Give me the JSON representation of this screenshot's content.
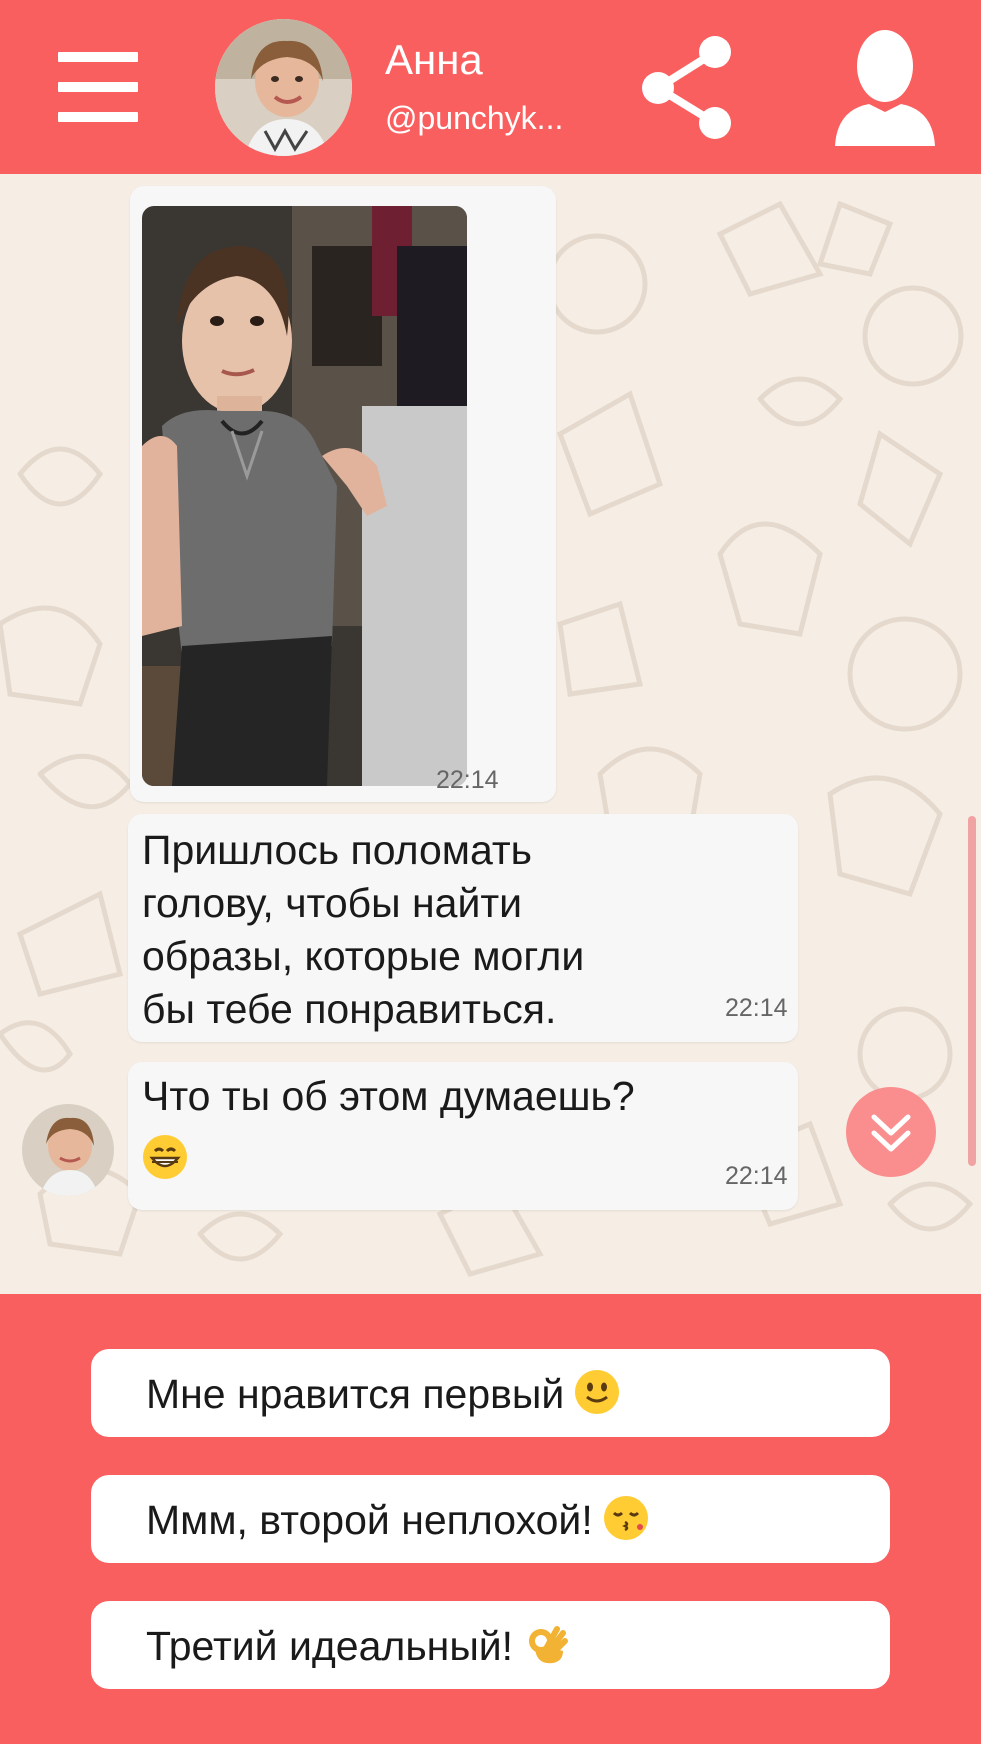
{
  "header": {
    "name": "Анна",
    "handle": "@punchyk...",
    "menu_icon": "hamburger-menu-icon",
    "share_icon": "share-icon",
    "profile_icon": "user-profile-icon"
  },
  "messages": [
    {
      "type": "image",
      "time": "22:14"
    },
    {
      "type": "text",
      "lines": [
        "Пришлось поломать",
        "голову, чтобы найти",
        "образы, которые могли",
        "бы тебе понравиться."
      ],
      "time": "22:14"
    },
    {
      "type": "text",
      "lines": [
        "Что ты об этом думаешь?"
      ],
      "emoji": "grinning-face-emoji",
      "time": "22:14"
    }
  ],
  "answers": [
    {
      "label": "Мне нравится первый",
      "emoji": "slightly-smiling-face-emoji"
    },
    {
      "label": "Ммм, второй неплохой!",
      "emoji": "kissing-face-emoji"
    },
    {
      "label": "Третий идеальный!",
      "emoji": "ok-hand-emoji"
    }
  ],
  "colors": {
    "brand": "#fa5f5f",
    "bubble": "#f7f7f7",
    "chat_bg": "#f6eee5",
    "scroll_button": "#fa8e8e"
  }
}
